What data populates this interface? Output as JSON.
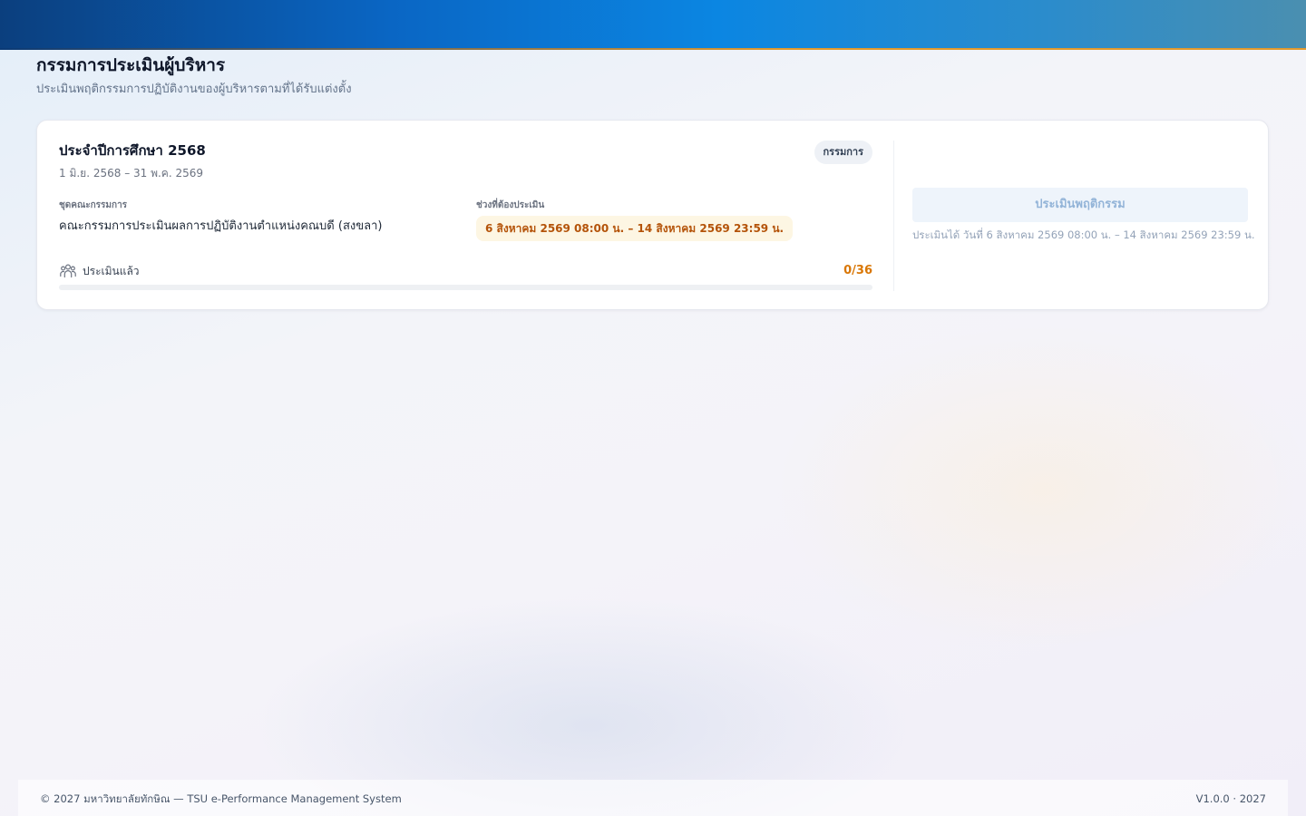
{
  "header": {
    "title": "กรรมการประเมินผู้บริหาร",
    "subtitle": "ประเมินพฤติกรรมการปฏิบัติงานของผู้บริหารตามที่ได้รับแต่งตั้ง"
  },
  "card": {
    "year_title": "ประจำปีการศึกษา 2568",
    "date_range": "1 มิ.ย. 2568 – 31 พ.ค. 2569",
    "role_badge": "กรรมการ",
    "committee_label": "ชุดคณะกรรมการ",
    "committee_value": "คณะกรรมการประเมินผลการปฏิบัติงานตำแหน่งคณบดี (สงขลา)",
    "period_label": "ช่วงที่ต้องประเมิน",
    "period_value": "6 สิงหาคม 2569 08:00 น. – 14 สิงหาคม 2569 23:59 น.",
    "progress_label": "ประเมินแล้ว",
    "progress_count": "0/36",
    "progress_fraction": 0,
    "progress_icon": "users-icon",
    "action_button": "ประเมินพฤติกรรม",
    "action_note": "ประเมินได้ วันที่ 6 สิงหาคม 2569 08:00 น. – 14 สิงหาคม 2569 23:59 น."
  },
  "footer": {
    "copyright": "© 2027 มหาวิทยาลัยทักษิณ — TSU e-Performance Management System",
    "version": "V1.0.0 · 2027"
  },
  "colors": {
    "accent_orange": "#d97706",
    "period_bg": "#fdf6e3",
    "button_bg_disabled": "#eef4fb",
    "button_text_disabled": "#93b4d8",
    "topbar_blue": "#0b86e2"
  }
}
